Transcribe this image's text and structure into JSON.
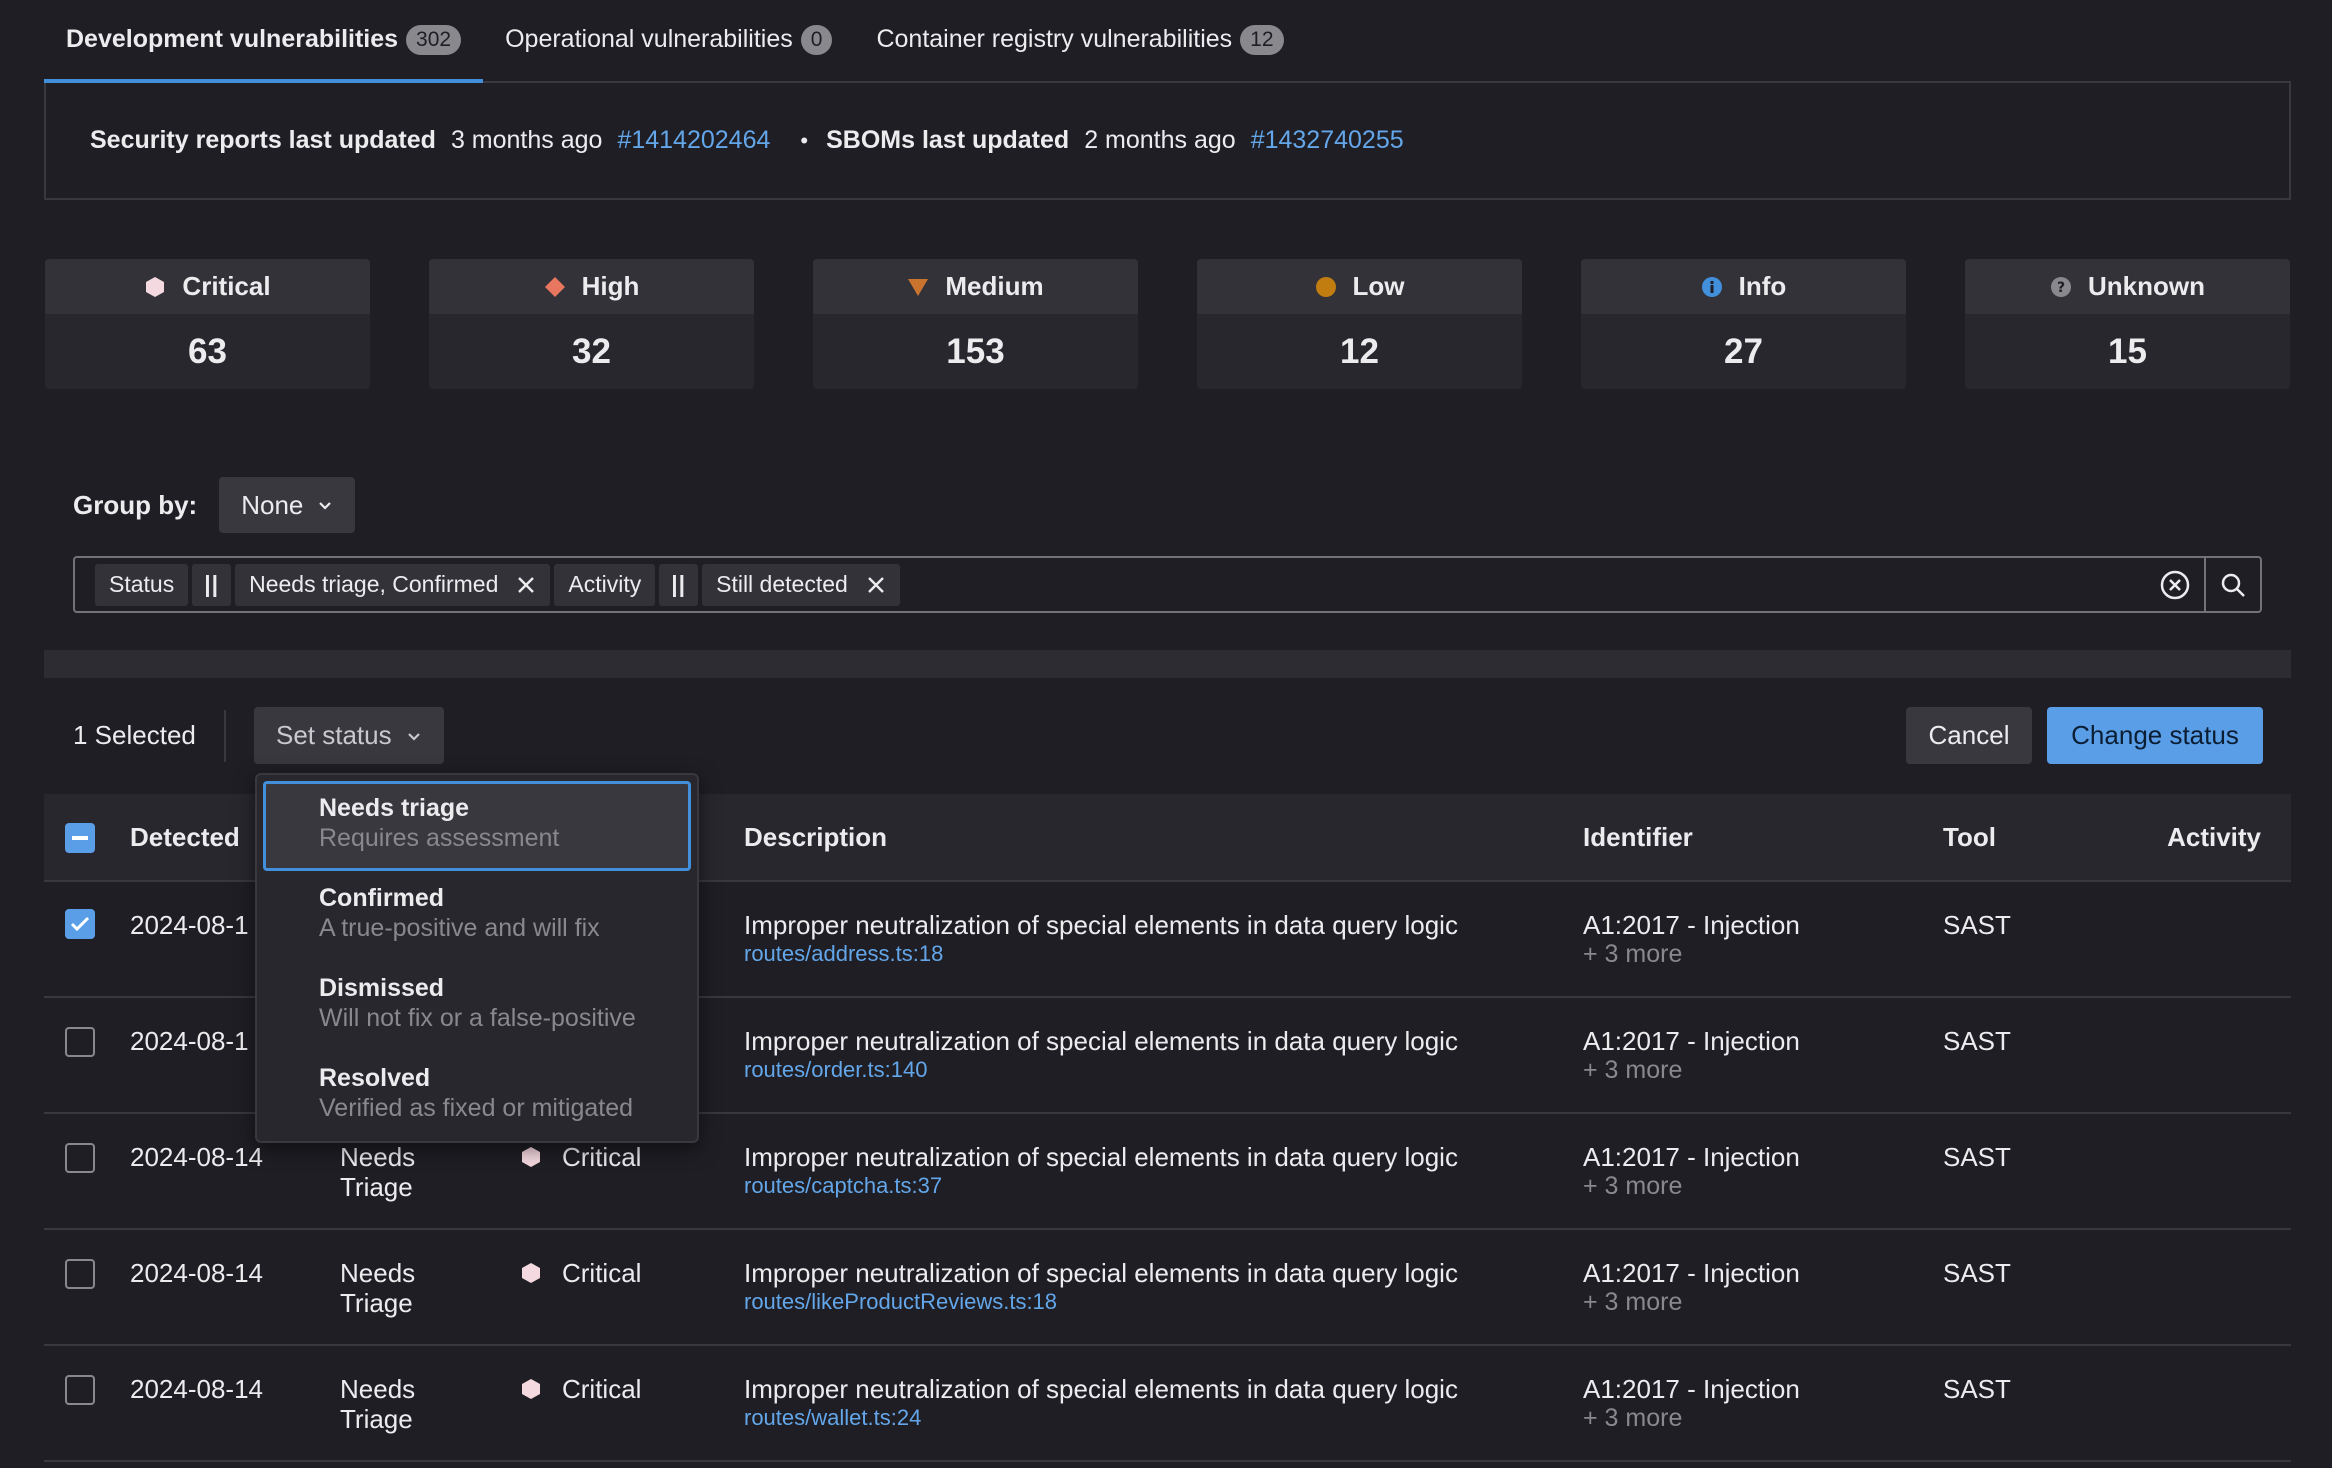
{
  "tabs": [
    {
      "label": "Development vulnerabilities",
      "count": "302"
    },
    {
      "label": "Operational vulnerabilities",
      "count": "0"
    },
    {
      "label": "Container registry vulnerabilities",
      "count": "12"
    }
  ],
  "reports": {
    "security_label": "Security reports last updated",
    "security_time": "3 months ago",
    "security_link": "#1414202464",
    "sbom_label": "SBOMs last updated",
    "sbom_time": "2 months ago",
    "sbom_link": "#1432740255"
  },
  "severities": [
    {
      "label": "Critical",
      "count": "63",
      "icon": "critical-icon",
      "color": "#f5d9e0"
    },
    {
      "label": "High",
      "count": "32",
      "icon": "high-icon",
      "color": "#e9775f"
    },
    {
      "label": "Medium",
      "count": "153",
      "icon": "medium-icon",
      "color": "#c8742f"
    },
    {
      "label": "Low",
      "count": "12",
      "icon": "low-icon",
      "color": "#c17d10"
    },
    {
      "label": "Info",
      "count": "27",
      "icon": "info-icon",
      "color": "#428fdc"
    },
    {
      "label": "Unknown",
      "count": "15",
      "icon": "unknown-icon",
      "color": "#89888d"
    }
  ],
  "group_by": {
    "label": "Group by:",
    "value": "None"
  },
  "filters": [
    {
      "key": "Status",
      "op": "||",
      "value": "Needs triage, Confirmed"
    },
    {
      "key": "Activity",
      "op": "||",
      "value": "Still detected"
    }
  ],
  "selection": {
    "count_label": "1 Selected",
    "set_status": "Set status",
    "cancel": "Cancel",
    "change_status": "Change status"
  },
  "status_options": [
    {
      "title": "Needs triage",
      "desc": "Requires assessment"
    },
    {
      "title": "Confirmed",
      "desc": "A true-positive and will fix"
    },
    {
      "title": "Dismissed",
      "desc": "Will not fix or a false-positive"
    },
    {
      "title": "Resolved",
      "desc": "Verified as fixed or mitigated"
    }
  ],
  "table": {
    "headers": {
      "detected": "Detected",
      "description": "Description",
      "identifier": "Identifier",
      "tool": "Tool",
      "activity": "Activity"
    },
    "rows": [
      {
        "detected": "2024-08-1",
        "status_l1": "",
        "status_l2": "",
        "severity": "",
        "desc": "Improper neutralization of special elements in data query logic",
        "file": "routes/address.ts:18",
        "identifier": "A1:2017 - Injection",
        "more": "+ 3 more",
        "tool": "SAST",
        "checked": true
      },
      {
        "detected": "2024-08-1",
        "status_l1": "",
        "status_l2": "",
        "severity": "",
        "desc": "Improper neutralization of special elements in data query logic",
        "file": "routes/order.ts:140",
        "identifier": "A1:2017 - Injection",
        "more": "+ 3 more",
        "tool": "SAST",
        "checked": false
      },
      {
        "detected": "2024-08-14",
        "status_l1": "Needs",
        "status_l2": "Triage",
        "severity": "Critical",
        "desc": "Improper neutralization of special elements in data query logic",
        "file": "routes/captcha.ts:37",
        "identifier": "A1:2017 - Injection",
        "more": "+ 3 more",
        "tool": "SAST",
        "checked": false
      },
      {
        "detected": "2024-08-14",
        "status_l1": "Needs",
        "status_l2": "Triage",
        "severity": "Critical",
        "desc": "Improper neutralization of special elements in data query logic",
        "file": "routes/likeProductReviews.ts:18",
        "identifier": "A1:2017 - Injection",
        "more": "+ 3 more",
        "tool": "SAST",
        "checked": false
      },
      {
        "detected": "2024-08-14",
        "status_l1": "Needs",
        "status_l2": "Triage",
        "severity": "Critical",
        "desc": "Improper neutralization of special elements in data query logic",
        "file": "routes/wallet.ts:24",
        "identifier": "A1:2017 - Injection",
        "more": "+ 3 more",
        "tool": "SAST",
        "checked": false
      }
    ]
  }
}
